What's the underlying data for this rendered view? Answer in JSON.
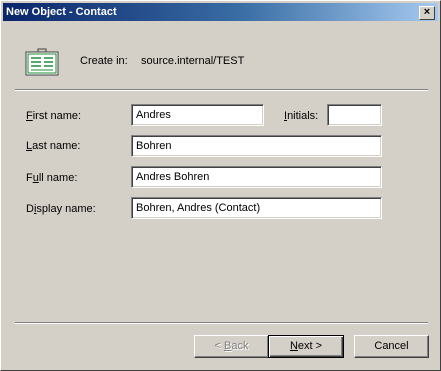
{
  "window": {
    "title": "New Object - Contact",
    "close_glyph": "×"
  },
  "header": {
    "icon": "contact-card-icon",
    "create_in_label": "Create in:",
    "create_in_path": "source.internal/TEST"
  },
  "form": {
    "first_name": {
      "mnemonic": "F",
      "rest": "irst name:",
      "value": "Andres"
    },
    "initials": {
      "mnemonic": "I",
      "rest": "nitials:",
      "value": ""
    },
    "last_name": {
      "mnemonic": "L",
      "rest": "ast name:",
      "value": "Bohren"
    },
    "full_name": {
      "pre": "F",
      "mnemonic": "u",
      "rest": "ll name:",
      "value": "Andres Bohren"
    },
    "display_name": {
      "pre": "D",
      "mnemonic": "i",
      "rest": "splay name:",
      "value": "Bohren, Andres (Contact)"
    }
  },
  "buttons": {
    "back": {
      "prefix": "< ",
      "mnemonic": "B",
      "rest": "ack"
    },
    "next": {
      "mnemonic": "N",
      "rest": "ext >"
    },
    "cancel": {
      "label": "Cancel"
    }
  },
  "colors": {
    "titlebar_start": "#0a246a",
    "titlebar_end": "#a6caf0",
    "face": "#d4d0c8",
    "icon_green": "#1e8c3a"
  }
}
